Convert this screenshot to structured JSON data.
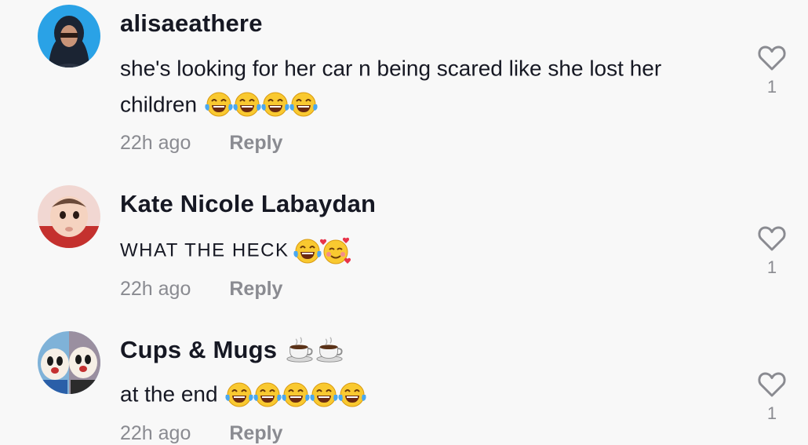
{
  "comments": [
    {
      "username": "alisaeathere",
      "text": "she's looking for her car n being scared like she lost her children",
      "emojis": [
        "laughing-tears",
        "laughing-tears",
        "laughing-tears",
        "laughing-tears"
      ],
      "time": "22h ago",
      "reply_label": "Reply",
      "like_count": "1",
      "like_icon": "heart-outline-icon"
    },
    {
      "username": "Kate Nicole Labaydan",
      "text": "WHAT THE HECK",
      "emojis": [
        "laughing-tears",
        "smiling-face-with-hearts"
      ],
      "time": "22h ago",
      "reply_label": "Reply",
      "like_count": "1",
      "like_icon": "heart-outline-icon"
    },
    {
      "username": "Cups & Mugs",
      "username_emojis": [
        "hot-beverage",
        "hot-beverage"
      ],
      "text": "at the end",
      "emojis": [
        "laughing-tears",
        "laughing-tears",
        "laughing-tears",
        "laughing-tears",
        "laughing-tears"
      ],
      "time": "22h ago",
      "reply_label": "Reply",
      "like_count": "1",
      "like_icon": "heart-outline-icon"
    }
  ],
  "colors": {
    "background": "#f8f8f8",
    "primary_text": "#161823",
    "secondary_text": "#8a8b91",
    "emoji_yellow": "#f9c930",
    "tear_blue": "#4aa8f0"
  }
}
